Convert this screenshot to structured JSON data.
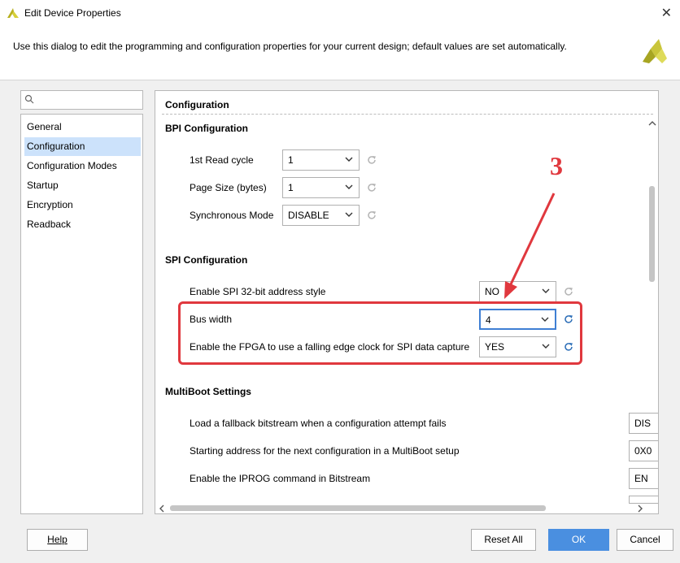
{
  "window": {
    "title": "Edit Device Properties"
  },
  "description": "Use this dialog to edit the programming and configuration properties for your current design; default values are set automatically.",
  "search": {
    "placeholder": ""
  },
  "nav": {
    "items": [
      {
        "label": "General",
        "selected": false
      },
      {
        "label": "Configuration",
        "selected": true
      },
      {
        "label": "Configuration Modes",
        "selected": false
      },
      {
        "label": "Startup",
        "selected": false
      },
      {
        "label": "Encryption",
        "selected": false
      },
      {
        "label": "Readback",
        "selected": false
      }
    ]
  },
  "panel": {
    "header": "Configuration",
    "bpi": {
      "title": "BPI Configuration",
      "rows": [
        {
          "label": "1st Read cycle",
          "value": "1"
        },
        {
          "label": "Page Size (bytes)",
          "value": "1"
        },
        {
          "label": "Synchronous Mode",
          "value": "DISABLE"
        }
      ]
    },
    "spi": {
      "title": "SPI Configuration",
      "rows": [
        {
          "label": "Enable SPI 32-bit address style",
          "value": "NO"
        },
        {
          "label": "Bus width",
          "value": "4"
        },
        {
          "label": "Enable the FPGA to use a falling edge clock for SPI data capture",
          "value": "YES"
        }
      ]
    },
    "multiboot": {
      "title": "MultiBoot Settings",
      "rows": [
        {
          "label": "Load a fallback bitstream when a configuration attempt fails",
          "value": "DIS"
        },
        {
          "label": "Starting address for the next configuration in a MultiBoot setup",
          "value": "0X0"
        },
        {
          "label": "Enable the IPROG command in Bitstream",
          "value": "EN"
        }
      ]
    }
  },
  "annotation": {
    "number": "3",
    "color": "#e0383e"
  },
  "buttons": {
    "help": "Help",
    "reset_all": "Reset All",
    "ok": "OK",
    "cancel": "Cancel"
  },
  "colors": {
    "accent": "#4a8fe0",
    "selection": "#cce2fb",
    "annotation": "#e0383e"
  }
}
